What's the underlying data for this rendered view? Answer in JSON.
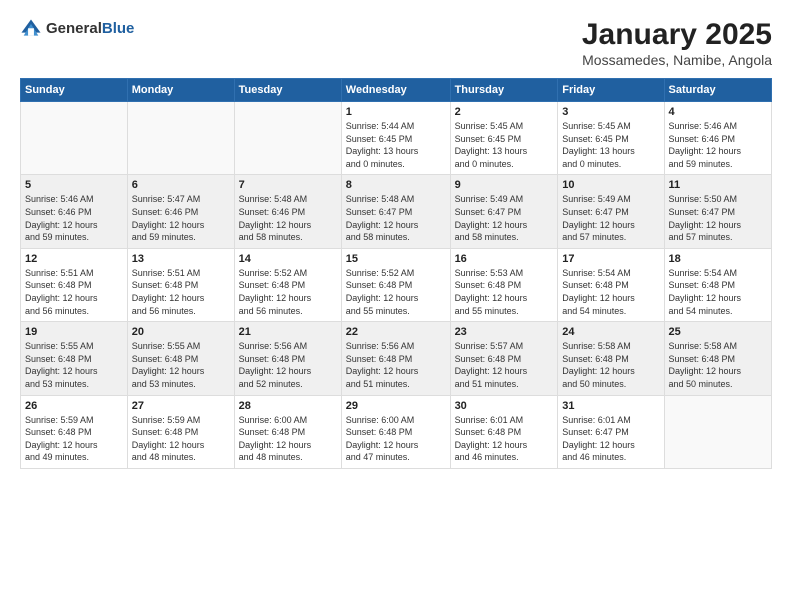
{
  "header": {
    "logo_general": "General",
    "logo_blue": "Blue",
    "main_title": "January 2025",
    "sub_title": "Mossamedes, Namibe, Angola"
  },
  "weekdays": [
    "Sunday",
    "Monday",
    "Tuesday",
    "Wednesday",
    "Thursday",
    "Friday",
    "Saturday"
  ],
  "weeks": [
    [
      {
        "day": "",
        "info": ""
      },
      {
        "day": "",
        "info": ""
      },
      {
        "day": "",
        "info": ""
      },
      {
        "day": "1",
        "info": "Sunrise: 5:44 AM\nSunset: 6:45 PM\nDaylight: 13 hours\nand 0 minutes."
      },
      {
        "day": "2",
        "info": "Sunrise: 5:45 AM\nSunset: 6:45 PM\nDaylight: 13 hours\nand 0 minutes."
      },
      {
        "day": "3",
        "info": "Sunrise: 5:45 AM\nSunset: 6:45 PM\nDaylight: 13 hours\nand 0 minutes."
      },
      {
        "day": "4",
        "info": "Sunrise: 5:46 AM\nSunset: 6:46 PM\nDaylight: 12 hours\nand 59 minutes."
      }
    ],
    [
      {
        "day": "5",
        "info": "Sunrise: 5:46 AM\nSunset: 6:46 PM\nDaylight: 12 hours\nand 59 minutes."
      },
      {
        "day": "6",
        "info": "Sunrise: 5:47 AM\nSunset: 6:46 PM\nDaylight: 12 hours\nand 59 minutes."
      },
      {
        "day": "7",
        "info": "Sunrise: 5:48 AM\nSunset: 6:46 PM\nDaylight: 12 hours\nand 58 minutes."
      },
      {
        "day": "8",
        "info": "Sunrise: 5:48 AM\nSunset: 6:47 PM\nDaylight: 12 hours\nand 58 minutes."
      },
      {
        "day": "9",
        "info": "Sunrise: 5:49 AM\nSunset: 6:47 PM\nDaylight: 12 hours\nand 58 minutes."
      },
      {
        "day": "10",
        "info": "Sunrise: 5:49 AM\nSunset: 6:47 PM\nDaylight: 12 hours\nand 57 minutes."
      },
      {
        "day": "11",
        "info": "Sunrise: 5:50 AM\nSunset: 6:47 PM\nDaylight: 12 hours\nand 57 minutes."
      }
    ],
    [
      {
        "day": "12",
        "info": "Sunrise: 5:51 AM\nSunset: 6:48 PM\nDaylight: 12 hours\nand 56 minutes."
      },
      {
        "day": "13",
        "info": "Sunrise: 5:51 AM\nSunset: 6:48 PM\nDaylight: 12 hours\nand 56 minutes."
      },
      {
        "day": "14",
        "info": "Sunrise: 5:52 AM\nSunset: 6:48 PM\nDaylight: 12 hours\nand 56 minutes."
      },
      {
        "day": "15",
        "info": "Sunrise: 5:52 AM\nSunset: 6:48 PM\nDaylight: 12 hours\nand 55 minutes."
      },
      {
        "day": "16",
        "info": "Sunrise: 5:53 AM\nSunset: 6:48 PM\nDaylight: 12 hours\nand 55 minutes."
      },
      {
        "day": "17",
        "info": "Sunrise: 5:54 AM\nSunset: 6:48 PM\nDaylight: 12 hours\nand 54 minutes."
      },
      {
        "day": "18",
        "info": "Sunrise: 5:54 AM\nSunset: 6:48 PM\nDaylight: 12 hours\nand 54 minutes."
      }
    ],
    [
      {
        "day": "19",
        "info": "Sunrise: 5:55 AM\nSunset: 6:48 PM\nDaylight: 12 hours\nand 53 minutes."
      },
      {
        "day": "20",
        "info": "Sunrise: 5:55 AM\nSunset: 6:48 PM\nDaylight: 12 hours\nand 53 minutes."
      },
      {
        "day": "21",
        "info": "Sunrise: 5:56 AM\nSunset: 6:48 PM\nDaylight: 12 hours\nand 52 minutes."
      },
      {
        "day": "22",
        "info": "Sunrise: 5:56 AM\nSunset: 6:48 PM\nDaylight: 12 hours\nand 51 minutes."
      },
      {
        "day": "23",
        "info": "Sunrise: 5:57 AM\nSunset: 6:48 PM\nDaylight: 12 hours\nand 51 minutes."
      },
      {
        "day": "24",
        "info": "Sunrise: 5:58 AM\nSunset: 6:48 PM\nDaylight: 12 hours\nand 50 minutes."
      },
      {
        "day": "25",
        "info": "Sunrise: 5:58 AM\nSunset: 6:48 PM\nDaylight: 12 hours\nand 50 minutes."
      }
    ],
    [
      {
        "day": "26",
        "info": "Sunrise: 5:59 AM\nSunset: 6:48 PM\nDaylight: 12 hours\nand 49 minutes."
      },
      {
        "day": "27",
        "info": "Sunrise: 5:59 AM\nSunset: 6:48 PM\nDaylight: 12 hours\nand 48 minutes."
      },
      {
        "day": "28",
        "info": "Sunrise: 6:00 AM\nSunset: 6:48 PM\nDaylight: 12 hours\nand 48 minutes."
      },
      {
        "day": "29",
        "info": "Sunrise: 6:00 AM\nSunset: 6:48 PM\nDaylight: 12 hours\nand 47 minutes."
      },
      {
        "day": "30",
        "info": "Sunrise: 6:01 AM\nSunset: 6:48 PM\nDaylight: 12 hours\nand 46 minutes."
      },
      {
        "day": "31",
        "info": "Sunrise: 6:01 AM\nSunset: 6:47 PM\nDaylight: 12 hours\nand 46 minutes."
      },
      {
        "day": "",
        "info": ""
      }
    ]
  ]
}
